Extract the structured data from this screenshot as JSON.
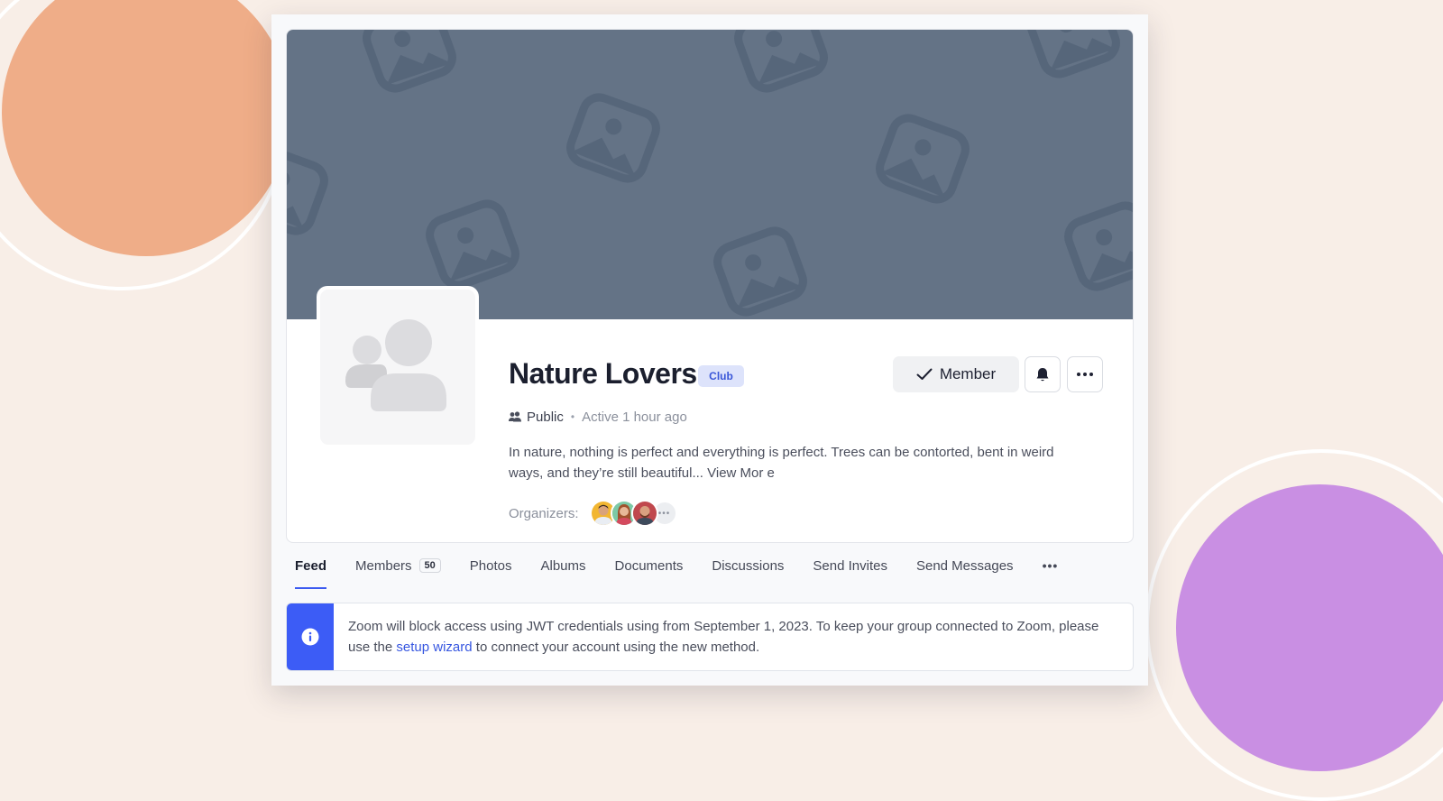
{
  "group": {
    "name": "Nature Lovers",
    "type_badge": "Club",
    "privacy": "Public",
    "activity": "Active 1 hour ago",
    "description": "In nature, nothing is perfect and everything is perfect. Trees can be contorted, bent in weird ways, and they’re still beautiful...",
    "view_more": "View Mor e",
    "organizers_label": "Organizers:",
    "organizers_more": "•••"
  },
  "actions": {
    "member_label": "Member",
    "bell_icon": "bell-icon",
    "more_icon": "more-horizontal-icon"
  },
  "tabs": [
    {
      "label": "Feed",
      "active": true
    },
    {
      "label": "Members",
      "count": "50"
    },
    {
      "label": "Photos"
    },
    {
      "label": "Albums"
    },
    {
      "label": "Documents"
    },
    {
      "label": "Discussions"
    },
    {
      "label": "Send Invites"
    },
    {
      "label": "Send Messages"
    }
  ],
  "tabs_overflow": "•••",
  "notice": {
    "text_before": "Zoom will block access using JWT credentials using from September 1, 2023. To keep your group connected to Zoom, please use the",
    "link": "setup wizard",
    "text_after": "to connect your account using the new method."
  },
  "colors": {
    "accent": "#3c5cf6",
    "cover": "#647386",
    "badge_bg": "#dde3fb",
    "badge_text": "#3956d8"
  }
}
